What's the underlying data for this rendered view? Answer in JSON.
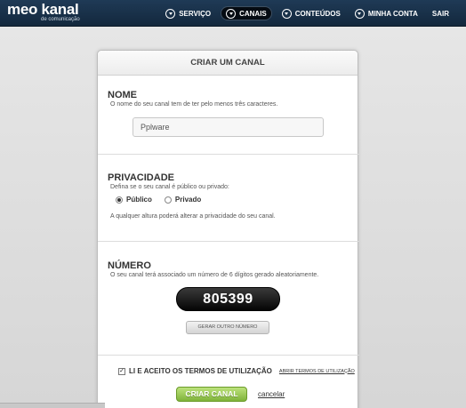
{
  "header": {
    "logo": "meo kanal",
    "logo_sub": "de comunicação",
    "nav": [
      {
        "label": "SERVIÇO",
        "active": false
      },
      {
        "label": "CANAIS",
        "active": true
      },
      {
        "label": "CONTEÚDOS",
        "active": false
      },
      {
        "label": "MINHA CONTA",
        "active": false
      },
      {
        "label": "SAIR",
        "active": false
      }
    ]
  },
  "form": {
    "title": "CRIAR UM CANAL",
    "name": {
      "title": "NOME",
      "hint": "O nome do seu canal tem de ter pelo menos três caracteres.",
      "value": "Pplware"
    },
    "privacy": {
      "title": "PRIVACIDADE",
      "hint": "Defina se o seu canal é público ou privado:",
      "options": [
        {
          "label": "Público",
          "checked": true
        },
        {
          "label": "Privado",
          "checked": false
        }
      ],
      "note": "A qualquer altura poderá alterar a privacidade do seu canal."
    },
    "number": {
      "title": "NÚMERO",
      "hint": "O seu canal terá associado um número de 6 dígitos gerado aleatoriamente.",
      "value": "805399",
      "regenerate_label": "GERAR OUTRO NÚMERO"
    },
    "terms": {
      "label": "LI E ACEITO OS TERMOS DE UTILIZAÇÃO",
      "link": "ABRIR TERMOS DE UTILIZAÇÃO",
      "checked": true,
      "check_mark": "✓"
    },
    "submit_label": "CRIAR CANAL",
    "cancel_label": "cancelar"
  },
  "colors": {
    "topbar": "#1a3148",
    "create_button": "#8cc042"
  }
}
